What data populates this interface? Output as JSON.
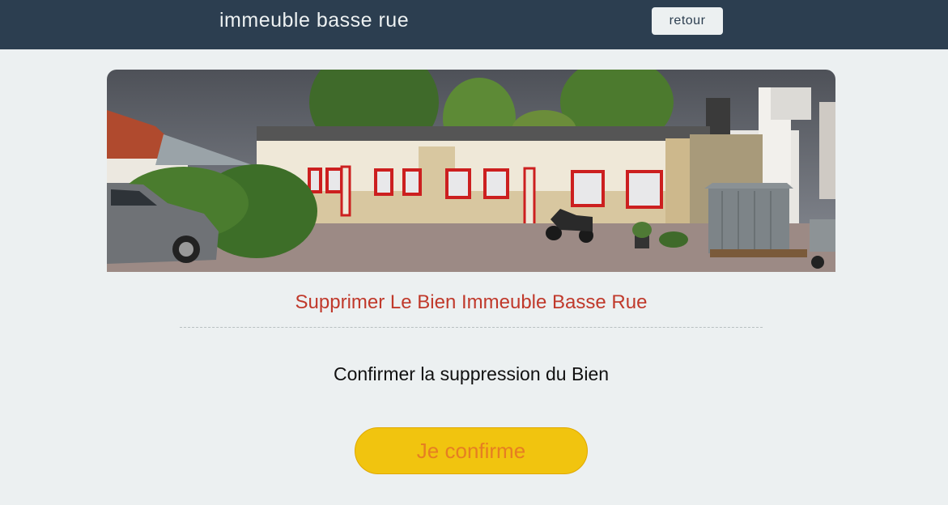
{
  "header": {
    "title": "immeuble basse rue",
    "back_label": "retour"
  },
  "photo": {
    "alt": "immeuble basse rue"
  },
  "main": {
    "heading": "Supprimer Le Bien Immeuble Basse Rue",
    "confirm_text": "Confirmer la suppression du Bien",
    "confirm_button": "Je confirme"
  },
  "colors": {
    "header_bg": "#2c3e50",
    "page_bg": "#ecf0f1",
    "heading": "#c0392b",
    "button_bg": "#f1c40f",
    "button_text": "#e67e22"
  }
}
